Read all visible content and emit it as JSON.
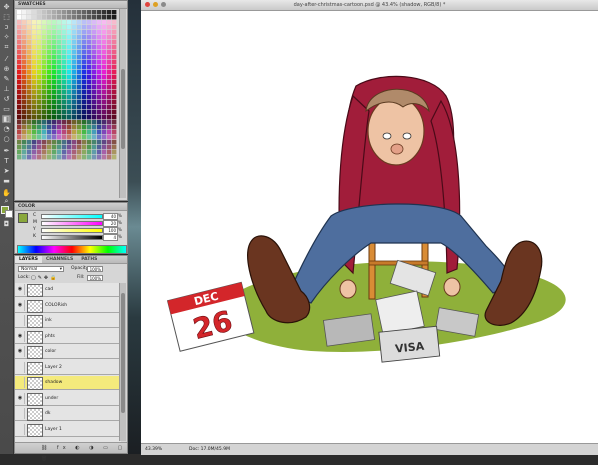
{
  "document": {
    "title": "day-after-christmas-cartoon.psd @ 43.4% (shadow, RGB/8) *",
    "zoom": "43.39%",
    "doc_info": "Doc: 17.0M/45.9M"
  },
  "panels": {
    "swatches": {
      "title": "SWATCHES"
    },
    "color": {
      "title": "COLOR",
      "sliders": [
        {
          "label": "C",
          "value": "40",
          "unit": "%"
        },
        {
          "label": "M",
          "value": "20",
          "unit": "%"
        },
        {
          "label": "Y",
          "value": "100",
          "unit": "%"
        },
        {
          "label": "K",
          "value": "4",
          "unit": "%"
        }
      ]
    },
    "layers": {
      "tabs": [
        "LAYERS",
        "CHANNELS",
        "PATHS"
      ],
      "blend_mode": "Normal",
      "opacity_label": "Opacity:",
      "opacity_value": "100%",
      "lock_label": "Lock:",
      "fill_label": "Fill:",
      "fill_value": "100%",
      "items": [
        {
          "name": "cad",
          "visible": true,
          "selected": false
        },
        {
          "name": "COLORish",
          "visible": true,
          "selected": false
        },
        {
          "name": "ink",
          "visible": false,
          "selected": false
        },
        {
          "name": "phts",
          "visible": true,
          "selected": false
        },
        {
          "name": "color",
          "visible": true,
          "selected": false
        },
        {
          "name": "Layer 2",
          "visible": false,
          "selected": false
        },
        {
          "name": "shadow",
          "visible": false,
          "selected": true
        },
        {
          "name": "under",
          "visible": true,
          "selected": false
        },
        {
          "name": "dk",
          "visible": false,
          "selected": false
        },
        {
          "name": "Layer 1",
          "visible": false,
          "selected": false
        }
      ]
    }
  },
  "artwork": {
    "calendar_month": "DEC",
    "calendar_day": "26",
    "receipt_text": "VISA"
  },
  "colors": {
    "foreground": "#8aa83c",
    "selected_layer": "#f4ea7c",
    "sweater": "#a11d3a",
    "jeans": "#4e6e9e",
    "grass": "#8fb03a"
  }
}
